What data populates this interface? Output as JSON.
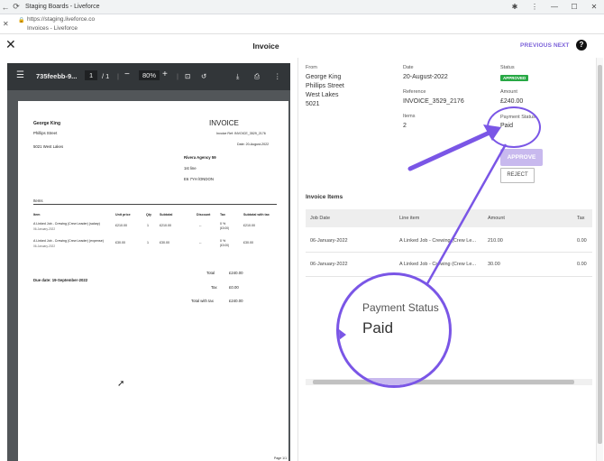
{
  "browser": {
    "tab_title": "Staging Boards - Liveforce",
    "url": "https://staging.liveforce.co",
    "page_title": "Invoices - Liveforce"
  },
  "header": {
    "title": "Invoice",
    "previous_label": "PREVIOUS",
    "next_label": "NEXT",
    "help_label": "?"
  },
  "pdf": {
    "filename": "735feebb-9...",
    "page_current": "1",
    "page_total": "/ 1",
    "zoom": "80%",
    "doc": {
      "from_name": "George King",
      "from_street": "Phillips Street",
      "from_city": "5021 West Lakes",
      "heading": "INVOICE",
      "invoice_ref": "Invoice Ref: INVOICE_3529_2176",
      "date": "Date: 20-August-2022",
      "to_name": "Rivera Agency 59",
      "to_line1": "1st line",
      "to_line2": "E6 7YH lONDON",
      "items_label": "Items",
      "columns": [
        "Item",
        "Unit price",
        "Qty",
        "Subtotal",
        "Discount",
        "Tax",
        "Subtotal with tax"
      ],
      "rows": [
        {
          "item": "A Linked Job - Crewing (Crew Leader) (salary)",
          "date": "06-January-2022",
          "unit": "£210.00",
          "qty": "1",
          "subtotal": "£210.00",
          "discount": "--",
          "tax": "0 %",
          "tax_amt": "(£0.00)",
          "subtotal_tax": "£210.00"
        },
        {
          "item": "A Linked Job - Crewing (Crew Leader) (expense)",
          "date": "06-January-2022",
          "unit": "£30.00",
          "qty": "1",
          "subtotal": "£30.00",
          "discount": "--",
          "tax": "0 %",
          "tax_amt": "(£0.00)",
          "subtotal_tax": "£30.00"
        }
      ],
      "due_date": "Due date: 19-September-2022",
      "total_label": "Total",
      "total_value": "£240.00",
      "tax_label": "Tax",
      "tax_value": "£0.00",
      "total_tax_label": "Total with tax",
      "total_tax_value": "£240.00",
      "page_footer": "Page 1/1"
    }
  },
  "details": {
    "from_label": "From",
    "from_lines": [
      "George King",
      "Phillips Street",
      "West Lakes",
      "5021"
    ],
    "date_label": "Date",
    "date_value": "20-August-2022",
    "status_label": "Status",
    "status_badge": "APPROVED",
    "reference_label": "Reference",
    "reference_value": "INVOICE_3529_2176",
    "amount_label": "Amount",
    "amount_value": "£240.00",
    "items_label": "Items",
    "items_value": "2",
    "payment_status_label": "Payment Status",
    "payment_status_value": "Paid",
    "approve_label": "APPROVE",
    "reject_label": "REJECT"
  },
  "invoice_items": {
    "title": "Invoice Items",
    "columns": [
      "Job Date",
      "Line item",
      "Amount",
      "Tax"
    ],
    "rows": [
      {
        "job_date": "06-January-2022",
        "line_item": "A Linked Job - Crewing (Crew Le...",
        "amount": "210.00",
        "tax": "0.00"
      },
      {
        "job_date": "06-January-2022",
        "line_item": "A Linked Job - Crewing (Crew Le...",
        "amount": "30.00",
        "tax": "0.00"
      }
    ]
  },
  "zoom_callout": {
    "label": "Payment Status",
    "value": "Paid"
  },
  "colors": {
    "accent": "#7b61d9",
    "annotation": "#7a56e6",
    "approved": "#27a844"
  }
}
